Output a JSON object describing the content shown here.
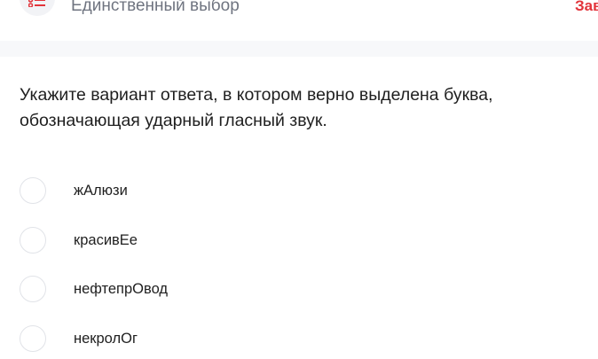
{
  "header": {
    "type_title": "Единственный выбор",
    "finish_label": "Зав",
    "icon": "list-icon"
  },
  "question": {
    "text": "Укажите вариант ответа, в котором верно выделена буква, обозначающая ударный гласный звук."
  },
  "options": [
    {
      "label": "жАлюзи"
    },
    {
      "label": "красивЕе"
    },
    {
      "label": "нефтепрОвод"
    },
    {
      "label": "некролОг"
    }
  ],
  "colors": {
    "accent": "#e2343b",
    "muted_text": "#6f7480",
    "radio_border": "#e1e3e8"
  }
}
